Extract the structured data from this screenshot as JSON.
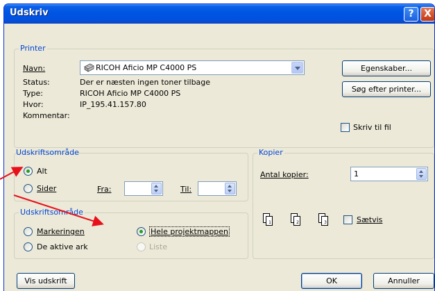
{
  "window": {
    "title": "Udskriv",
    "help_label": "?",
    "close_label": "X"
  },
  "printer": {
    "legend": "Printer",
    "name_label": "Navn:",
    "name_value": "RICOH Aficio MP C4000 PS",
    "status_label": "Status:",
    "status_value": "Der er næsten ingen toner tilbage",
    "type_label": "Type:",
    "type_value": "RICOH Aficio MP C4000 PS",
    "where_label": "Hvor:",
    "where_value": "IP_195.41.157.80",
    "comment_label": "Kommentar:",
    "properties_button": "Egenskaber...",
    "find_printer_button": "Søg efter printer...",
    "print_to_file_label": "Skriv til fil"
  },
  "range": {
    "legend": "Udskriftsområde",
    "all_label": "Alt",
    "pages_label": "Sider",
    "from_label": "Fra:",
    "from_value": "",
    "to_label": "Til:",
    "to_value": ""
  },
  "print_what": {
    "legend": "Udskriftsområde",
    "selection_label": "Markeringen",
    "entire_workbook_label": "Hele projektmappen",
    "active_sheets_label": "De aktive ark",
    "list_label": "Liste"
  },
  "copies": {
    "legend": "Kopier",
    "number_label": "Antal kopier:",
    "number_value": "1",
    "collate_label": "Sætvis",
    "page_numbers": [
      "1",
      "2",
      "3"
    ]
  },
  "footer": {
    "preview_button": "Vis udskrift",
    "ok_button": "OK",
    "cancel_button": "Annuller"
  },
  "colors": {
    "highlight": "#f5f000",
    "arrow": "#e8101a",
    "legend_text": "#0046d5",
    "title_bar": "#0054e3"
  }
}
